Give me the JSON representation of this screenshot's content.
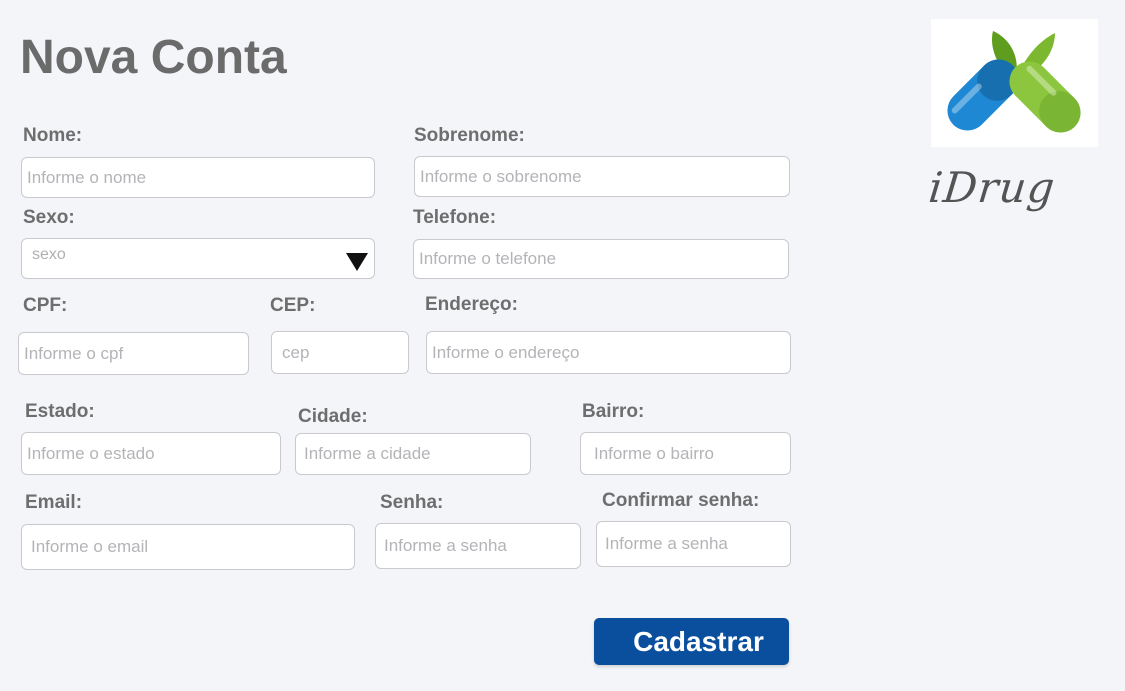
{
  "page": {
    "title": "Nova Conta"
  },
  "brand": {
    "name": "iDrug"
  },
  "form": {
    "nome": {
      "label": "Nome:",
      "placeholder": "Informe o nome",
      "value": ""
    },
    "sobrenome": {
      "label": "Sobrenome:",
      "placeholder": "Informe o sobrenome",
      "value": ""
    },
    "sexo": {
      "label": "Sexo:",
      "selected": "sexo"
    },
    "telefone": {
      "label": "Telefone:",
      "placeholder": "Informe o telefone",
      "value": ""
    },
    "cpf": {
      "label": "CPF:",
      "placeholder": "Informe o cpf",
      "value": ""
    },
    "cep": {
      "label": "CEP:",
      "placeholder": "cep",
      "value": ""
    },
    "endereco": {
      "label": "Endereço:",
      "placeholder": "Informe o endereço",
      "value": ""
    },
    "estado": {
      "label": "Estado:",
      "placeholder": "Informe o estado",
      "value": ""
    },
    "cidade": {
      "label": "Cidade:",
      "placeholder": "Informe a cidade",
      "value": ""
    },
    "bairro": {
      "label": "Bairro:",
      "placeholder": "Informe o bairro",
      "value": ""
    },
    "email": {
      "label": "Email:",
      "placeholder": "Informe o email",
      "value": ""
    },
    "senha": {
      "label": "Senha:",
      "placeholder": "Informe a senha",
      "value": ""
    },
    "confirmar_senha": {
      "label": "Confirmar senha:",
      "placeholder": "Informe a senha",
      "value": ""
    },
    "submit_label": "Cadastrar"
  },
  "colors": {
    "background": "#f4f5f9",
    "title": "#6b6b6b",
    "button": "#0a4f9e",
    "pill_blue": "#1e88d4",
    "pill_green": "#8cc63f",
    "leaf_green": "#5f9d1e"
  },
  "icons": {
    "logo": "capsule-leaves-logo-icon",
    "dropdown": "caret-down-icon"
  }
}
